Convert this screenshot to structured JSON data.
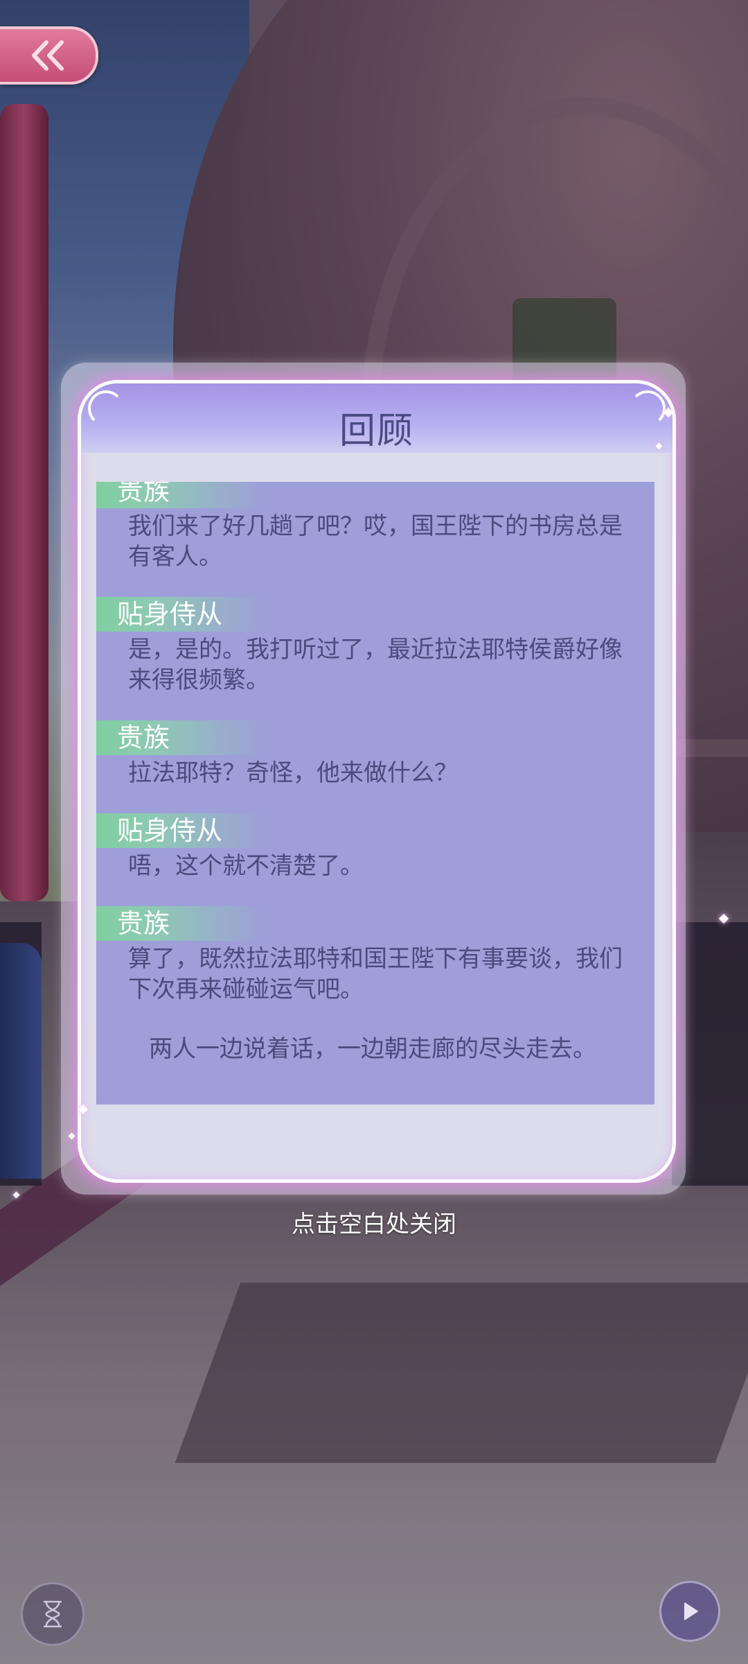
{
  "dialog": {
    "title": "回顾",
    "entries": [
      {
        "speaker": "贵族",
        "text": "我们来了好几趟了吧？哎，国王陛下的书房总是有客人。"
      },
      {
        "speaker": "贴身侍从",
        "text": "是，是的。我打听过了，最近拉法耶特侯爵好像来得很频繁。"
      },
      {
        "speaker": "贵族",
        "text": "拉法耶特？奇怪，他来做什么？"
      },
      {
        "speaker": "贴身侍从",
        "text": "唔，这个就不清楚了。"
      },
      {
        "speaker": "贵族",
        "text": "算了，既然拉法耶特和国王陛下有事要谈，我们下次再来碰碰运气吧。"
      }
    ],
    "narration": "两人一边说着话，一边朝走廊的尽头走去。"
  },
  "close_hint": "点击空白处关闭",
  "icons": {
    "back": "double-chevron-left-icon",
    "auto": "hourglass-icon",
    "play": "play-icon"
  },
  "colors": {
    "header": "#a594e6",
    "scroll_bg": "#9e9fd9",
    "speaker_tag": "#7fcfa0",
    "text": "#4a4a7e",
    "back_button": "#c64d77"
  }
}
